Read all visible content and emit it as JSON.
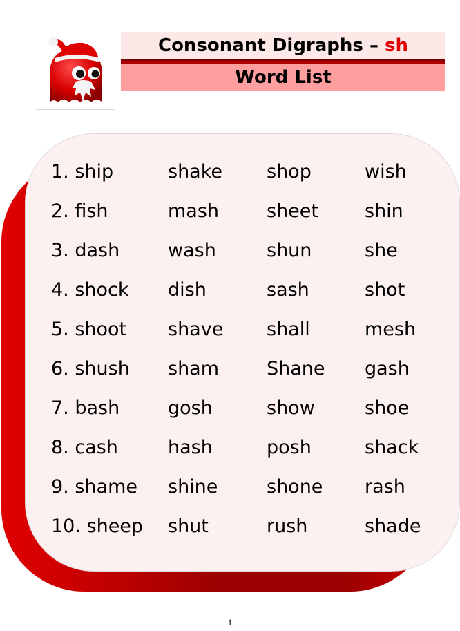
{
  "header": {
    "title_main": "Consonant Digraphs – ",
    "title_accent": "sh",
    "subtitle": "Word List",
    "accent_color": "#e00000"
  },
  "logo": {
    "icon": "santa-ghost-icon"
  },
  "word_list": {
    "rows": [
      [
        "1. ship",
        "shake",
        "shop",
        "wish"
      ],
      [
        "2. fish",
        "mash",
        "sheet",
        "shin"
      ],
      [
        "3. dash",
        "wash",
        "shun",
        "she"
      ],
      [
        "4. shock",
        "dish",
        "sash",
        "shot"
      ],
      [
        "5. shoot",
        "shave",
        "shall",
        "mesh"
      ],
      [
        "6. shush",
        "sham",
        "Shane",
        "gash"
      ],
      [
        "7. bash",
        "gosh",
        "show",
        "shoe"
      ],
      [
        "8. cash",
        "hash",
        "posh",
        "shack"
      ],
      [
        "9. shame",
        "shine",
        "shone",
        "rash"
      ],
      [
        "10. sheep",
        "shut",
        "rush",
        "shade"
      ]
    ]
  },
  "footer": {
    "page_number": "1"
  }
}
